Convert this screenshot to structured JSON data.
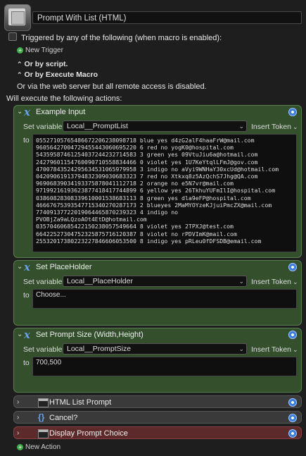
{
  "macro": {
    "title": "Prompt With List (HTML)"
  },
  "triggers": {
    "triggered_label": "Triggered by any of the following (when macro is enabled):",
    "new_trigger": "New Trigger",
    "or_script": "Or by script.",
    "or_execute": "Or by Execute Macro",
    "web_server": "Or via the web server but all remote access is disabled."
  },
  "actions_heading": "Will execute the following actions:",
  "actions": [
    {
      "title": "Example Input",
      "set_variable_label": "Set variable",
      "variable": "Local__PromptList",
      "insert_token": "Insert Token",
      "to_label": "to",
      "text": "05527105765486672206238098718 blue yes d4zG2alF4haaFrW@mail.com\n96056427004729455443060695220 6 red no yogK0@hospital.com\n54359587461254037244232714583 3 green yes 09VtuJiu6a@hotmail.com\n24279601154760090710558834466 0 violet yes 1U7KeYtqlLFmJ@gov.com\n47007843524295634531065979958 3 indigo no aVyi9WNHaY30xcUd@hotmail.com\n04209061913794832309030683323 7 red no Xtkxq8z5AzQchS7Jhg@QA.com\n96906839034193375878041112718 2 orange no e5N7vr@mail.com\n97199216193623877418417744899 6 yellow yes 26TkhuYUFmIlI@hospital.com\n03860828308339610001538683113 8 green yes dla9eFP@hospital.com\n46667675393547715340270287173 2 blueyes 2MaMYOYzeKJjuiPmcZX@mail.com\n77409137722019064465870239323 4 indigo no\nPVOBjZa9aLQzoAOt4EtD@hotmail.com\n03570460685422150238057549664 8 violet yes 2TPXJ@test.com\n66422527304752325875716120387 8 violet no rPDVImK@mail.com\n25532017380223227846606053500 8 indigo yes pRLeu0fDFSDB@email.com"
    },
    {
      "title": "Set PlaceHolder",
      "set_variable_label": "Set variable",
      "variable": "Local__PlaceHolder",
      "insert_token": "Insert Token",
      "to_label": "to",
      "text": "Choose..."
    },
    {
      "title": "Set Prompt Size (Width,Height)",
      "set_variable_label": "Set variable",
      "variable": "Local__PromptSize",
      "insert_token": "Insert Token",
      "to_label": "to",
      "text": "700,500"
    },
    {
      "title": "HTML List Prompt"
    },
    {
      "title": "Cancel?"
    },
    {
      "title": "Display Prompt Choice"
    }
  ],
  "new_action": "New Action",
  "colors": {
    "panel_green": "#334f2c",
    "panel_red": "#5c2a2a",
    "panel_grey": "#3a3a3a",
    "accent_blue": "#3b7fe0",
    "add_green": "#3fb04b"
  }
}
